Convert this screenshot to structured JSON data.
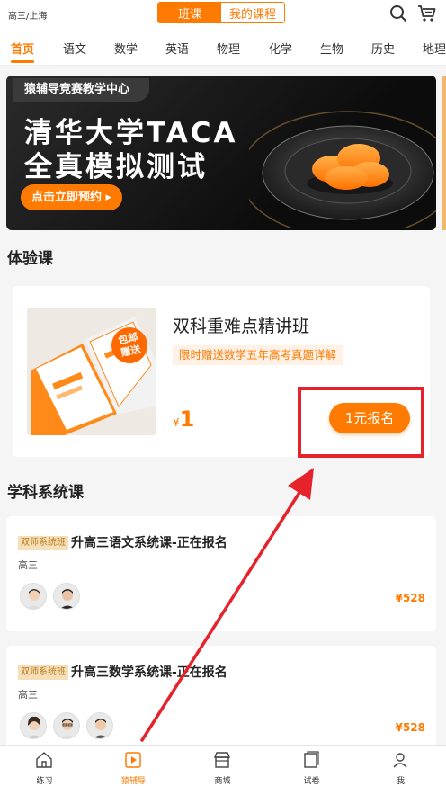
{
  "header": {
    "location": "高三/上海",
    "segments": [
      "班课",
      "我的课程"
    ],
    "icons": [
      "search-icon",
      "cart-icon"
    ]
  },
  "subjects": [
    "首页",
    "语文",
    "数学",
    "英语",
    "物理",
    "化学",
    "生物",
    "历史",
    "地理"
  ],
  "banner": {
    "tag": "猿辅导竞赛教学中心",
    "line1": "清华大学TACA",
    "line2": "全真模拟测试",
    "button": "点击立即预约 ▸"
  },
  "trial": {
    "section_title": "体验课",
    "book_badge": "包邮赠送",
    "title": "双科重难点精讲班",
    "promo": "限时赠送数学五年高考真题详解",
    "currency": "¥",
    "price": "1",
    "button": "1元报名"
  },
  "system": {
    "section_title": "学科系统课",
    "courses": [
      {
        "tag": "双师系统班",
        "title": "升高三语文系统课-正在报名",
        "grade": "高三",
        "price": "¥528"
      },
      {
        "tag": "双师系统班",
        "title": "升高三数学系统课-正在报名",
        "grade": "高三",
        "price": "¥528"
      }
    ]
  },
  "tabs": [
    "练习",
    "猿辅导",
    "商城",
    "试卷",
    "我"
  ],
  "colors": {
    "accent": "#ff7a00",
    "annotation": "#e6232a"
  }
}
